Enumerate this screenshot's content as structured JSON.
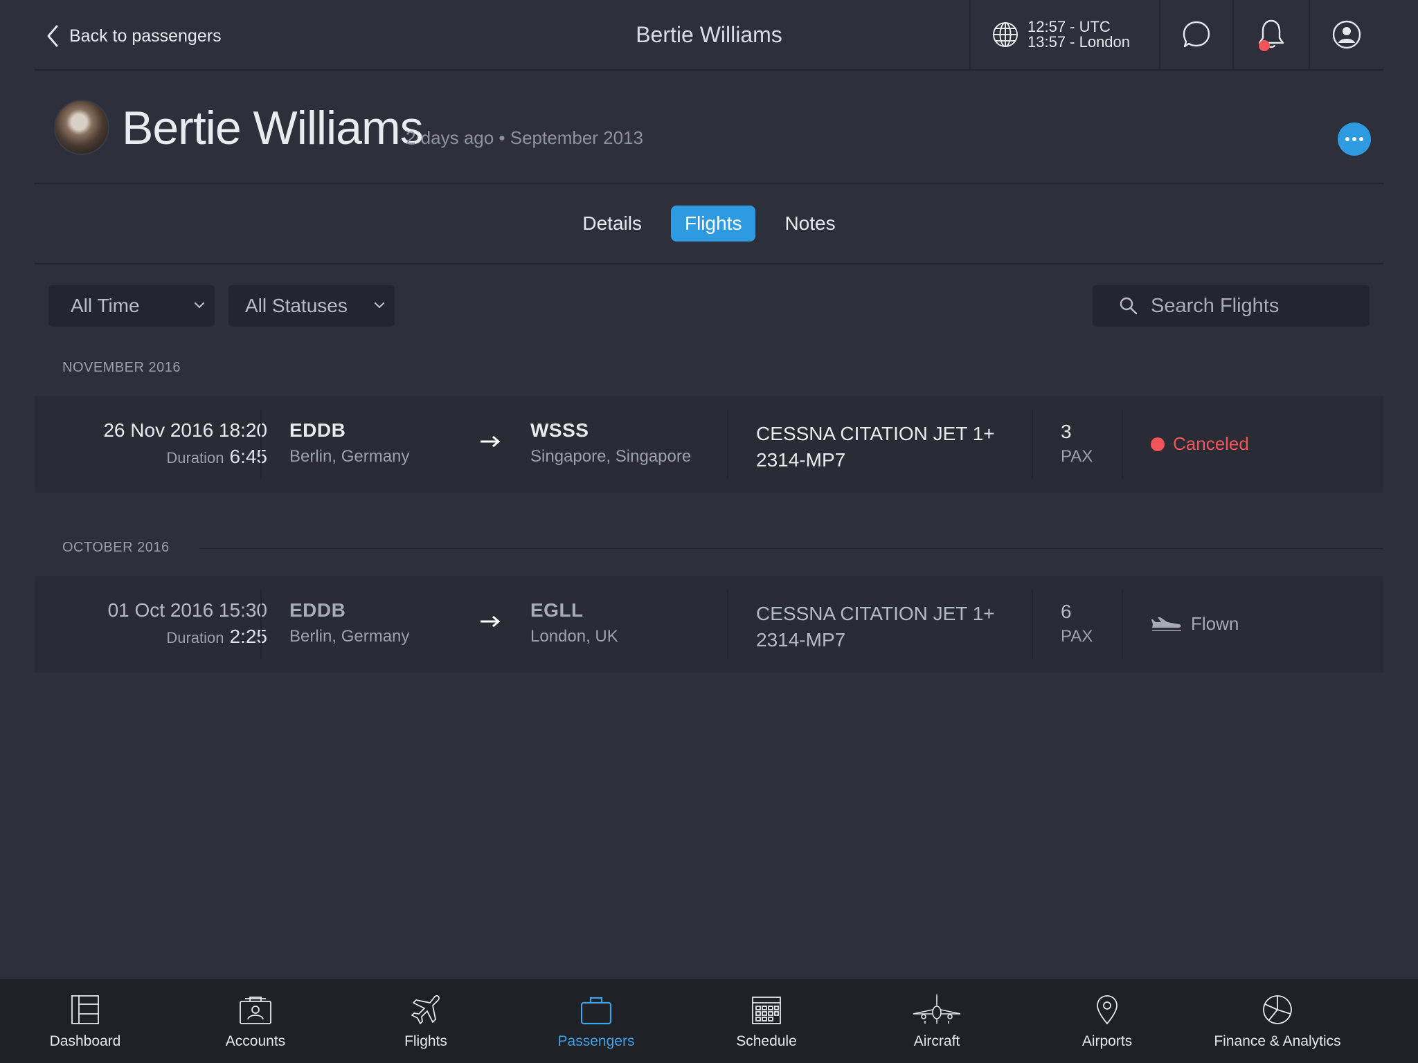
{
  "topbar": {
    "back_label": "Back to passengers",
    "title": "Bertie Williams",
    "time_utc": "12:57 - UTC",
    "time_local": "13:57 - London"
  },
  "profile": {
    "name": "Bertie Williams",
    "meta": "2 days ago • September 2013"
  },
  "tabs": [
    {
      "label": "Details",
      "active": false
    },
    {
      "label": "Flights",
      "active": true
    },
    {
      "label": "Notes",
      "active": false
    }
  ],
  "filters": {
    "time": "All Time",
    "status": "All Statuses",
    "search_placeholder": "Search Flights"
  },
  "groups": [
    {
      "title": "NOVEMBER 2016",
      "flights": [
        {
          "datetime": "26 Nov 2016 18:20",
          "duration_label": "Duration",
          "duration": "6:45",
          "from_code": "EDDB",
          "from_city": "Berlin, Germany",
          "to_code": "WSSS",
          "to_city": "Singapore, Singapore",
          "aircraft": "CESSNA CITATION JET 1+",
          "registration": "2314-MP7",
          "pax": "3",
          "pax_label": "PAX",
          "status": "Canceled"
        }
      ]
    },
    {
      "title": "OCTOBER 2016",
      "flights": [
        {
          "datetime": "01 Oct 2016 15:30",
          "duration_label": "Duration",
          "duration": "2:25",
          "from_code": "EDDB",
          "from_city": "Berlin, Germany",
          "to_code": "EGLL",
          "to_city": "London, UK",
          "aircraft": "CESSNA CITATION JET 1+",
          "registration": "2314-MP7",
          "pax": "6",
          "pax_label": "PAX",
          "status": "Flown"
        }
      ]
    }
  ],
  "nav": [
    {
      "label": "Dashboard",
      "icon": "dashboard-icon"
    },
    {
      "label": "Accounts",
      "icon": "accounts-icon"
    },
    {
      "label": "Flights",
      "icon": "plane-icon"
    },
    {
      "label": "Passengers",
      "icon": "briefcase-icon",
      "active": true
    },
    {
      "label": "Schedule",
      "icon": "calendar-icon"
    },
    {
      "label": "Aircraft",
      "icon": "aircraft-icon"
    },
    {
      "label": "Airports",
      "icon": "map-pin-icon"
    },
    {
      "label": "Finance & Analytics",
      "icon": "pie-chart-icon"
    }
  ],
  "colors": {
    "background": "#2d303a",
    "accent": "#2e9ae0",
    "canceled": "#f1555a",
    "row": "#292c35",
    "bottom_bar": "#1f2127"
  }
}
